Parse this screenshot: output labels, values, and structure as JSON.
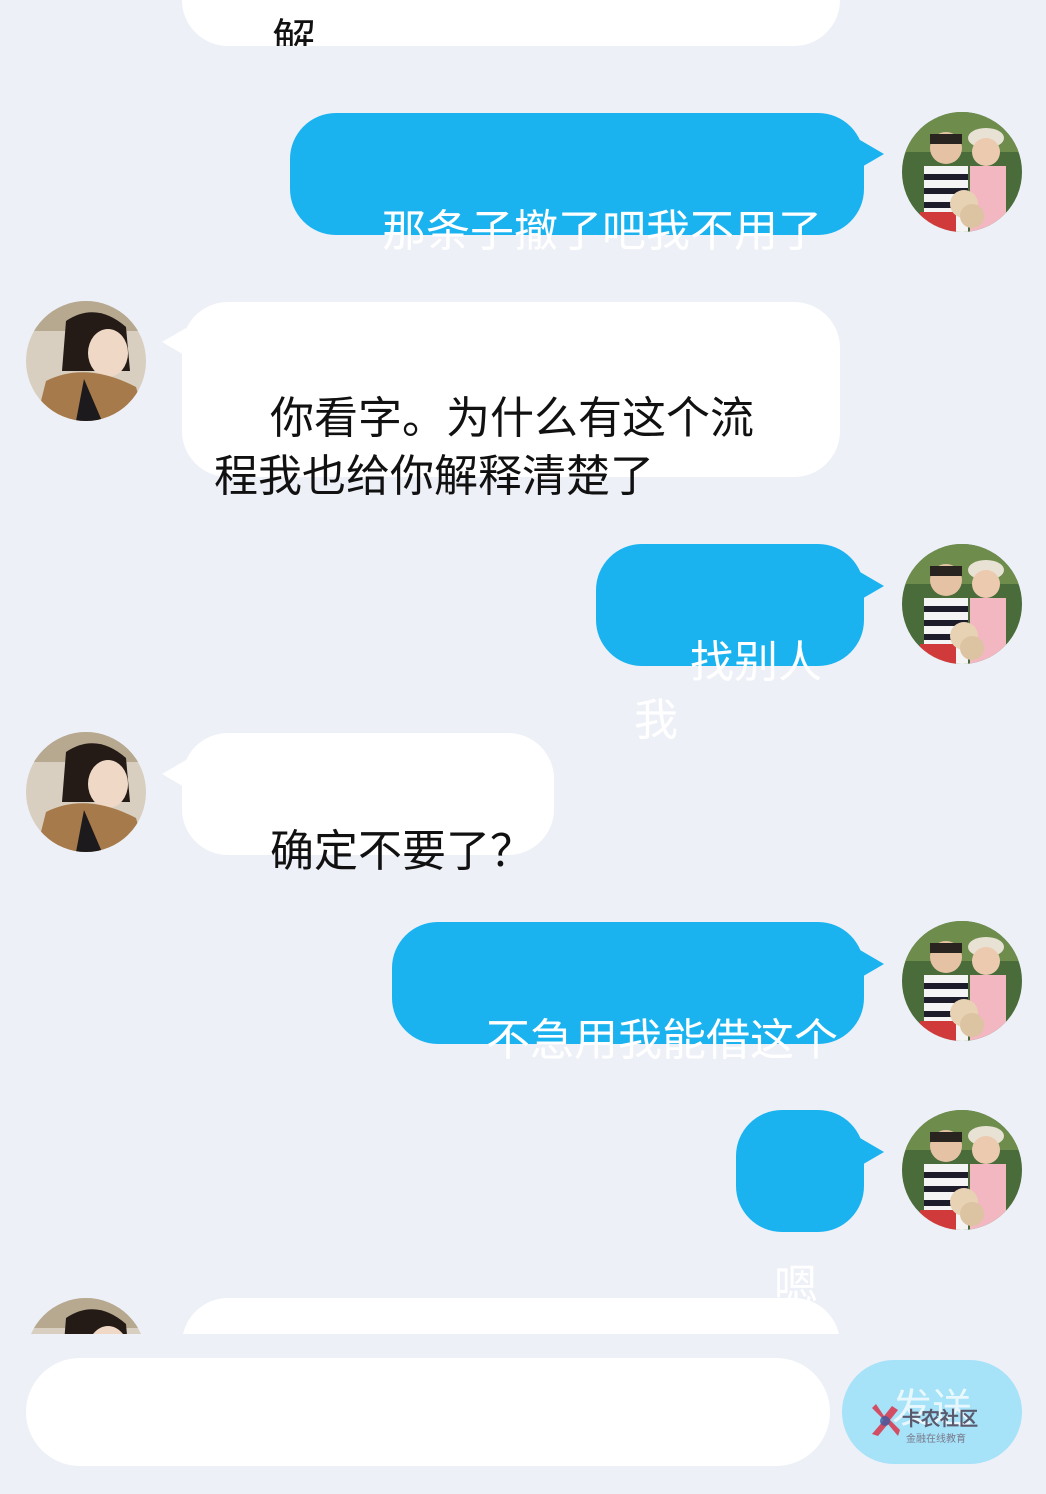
{
  "colors": {
    "background": "#edf0f7",
    "outgoing_bubble": "#1ab3f0",
    "incoming_bubble": "#ffffff",
    "send_button": "#a6e2f8"
  },
  "messages": [
    {
      "side": "left",
      "text": "解",
      "partial": true
    },
    {
      "side": "right",
      "text": "那条子撤了吧我不用了"
    },
    {
      "side": "left",
      "text": "你看字。为什么有这个流\n程我也给你解释清楚了"
    },
    {
      "side": "right",
      "text": "找别人我"
    },
    {
      "side": "left",
      "text": "确定不要了？"
    },
    {
      "side": "right",
      "text": "不急用我能借这个"
    },
    {
      "side": "right",
      "text": "嗯"
    },
    {
      "side": "left",
      "text": "",
      "partial": true
    }
  ],
  "input": {
    "value": "",
    "placeholder": ""
  },
  "send_button": {
    "label": "发送"
  },
  "watermark": {
    "title": "卡农社区",
    "subtitle": "金融在线教育"
  },
  "icons": {
    "incoming_avatar": "contact-avatar-photo",
    "outgoing_avatar": "self-avatar-photo",
    "watermark_logo": "kanong-logo-icon"
  }
}
